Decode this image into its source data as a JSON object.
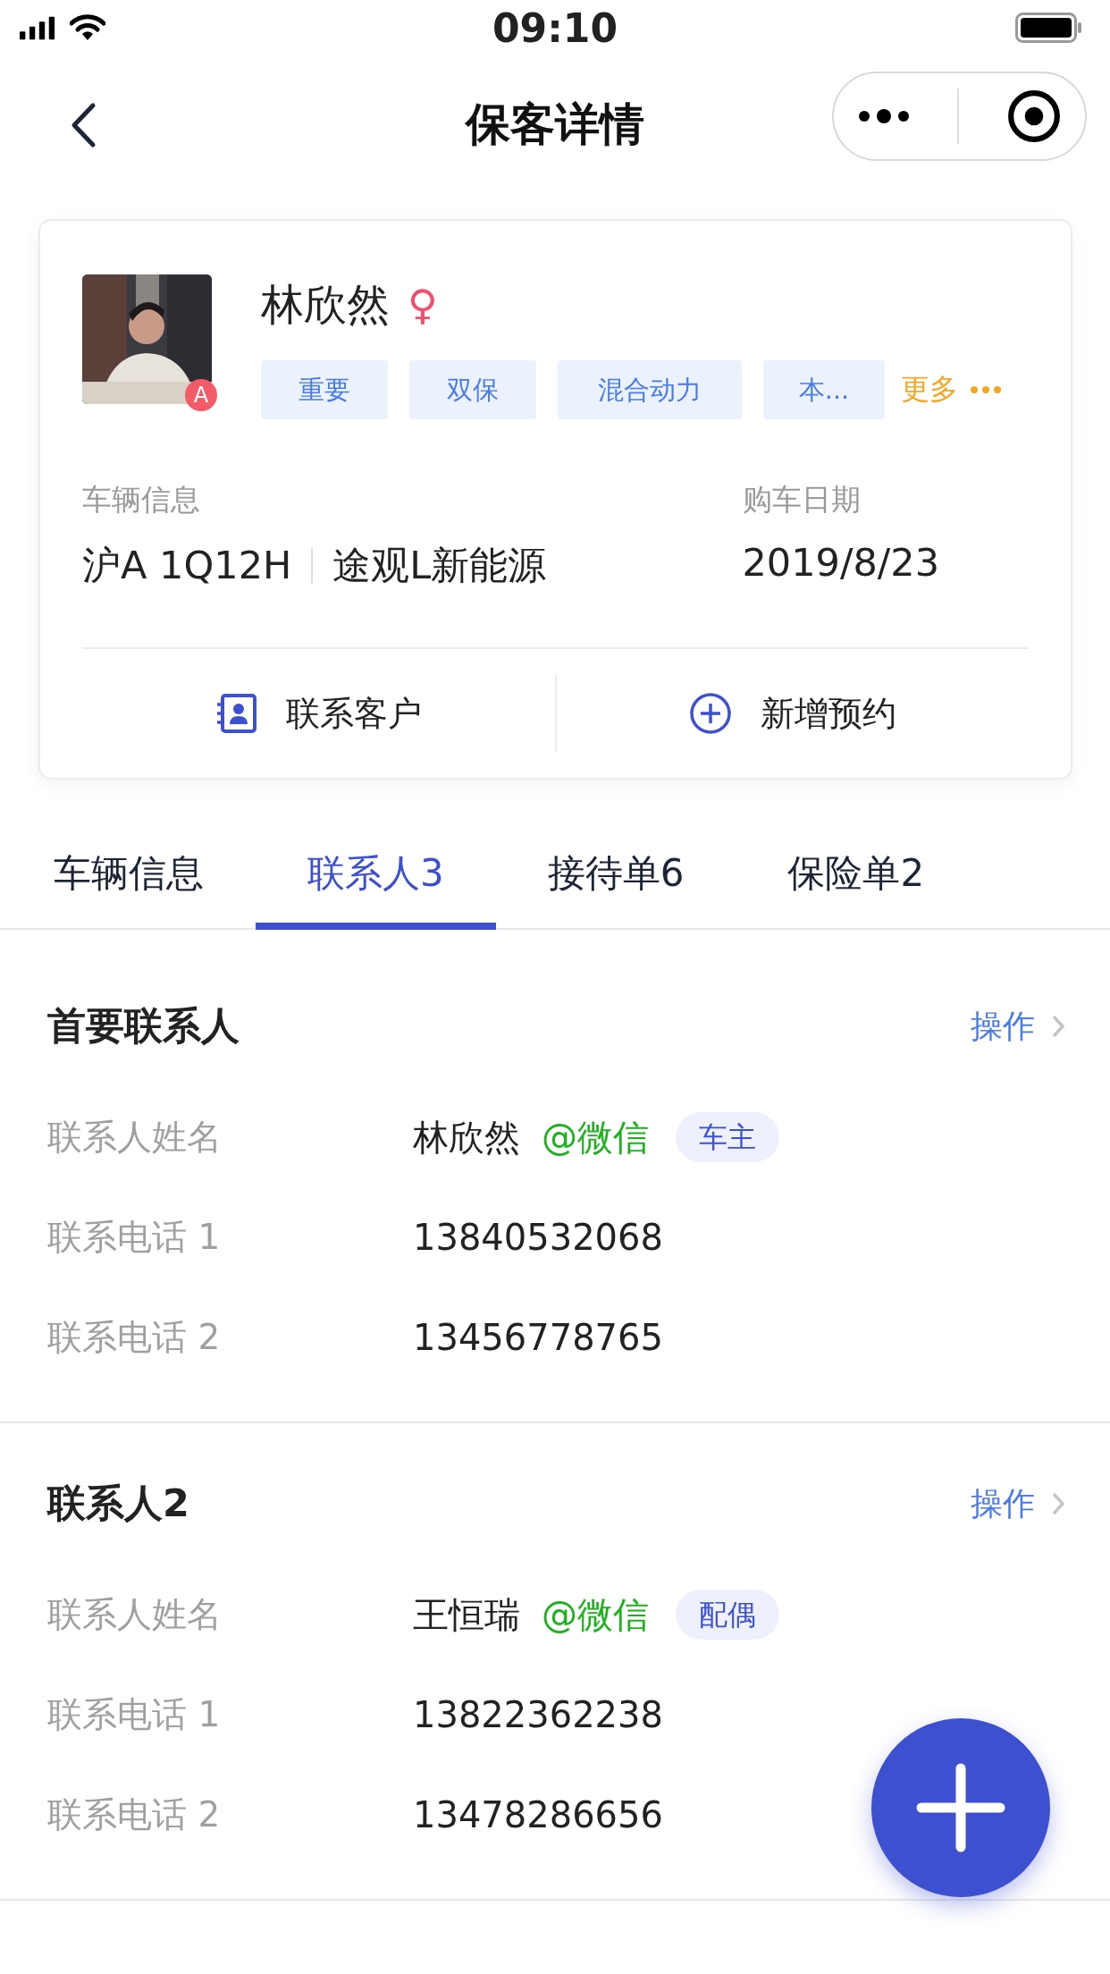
{
  "status_bar": {
    "time": "09:10"
  },
  "nav": {
    "title": "保客详情"
  },
  "customer": {
    "name": "林欣然",
    "gender_symbol": "♀",
    "avatar_badge": "A",
    "tags": [
      "重要",
      "双保",
      "混合动力",
      "本..."
    ],
    "more": "更多",
    "vehicle_label": "车辆信息",
    "plate": "沪A 1Q12H",
    "model": "途观L新能源",
    "date_label": "购车日期",
    "date": "2019/8/23",
    "actions": [
      {
        "kind": "contact",
        "label": "联系客户"
      },
      {
        "kind": "add",
        "label": "新增预约"
      }
    ]
  },
  "tabs": [
    {
      "label": "车辆信息",
      "selected": false
    },
    {
      "label": "联系人3",
      "selected": true
    },
    {
      "label": "接待单6",
      "selected": false
    },
    {
      "label": "保险单2",
      "selected": false
    }
  ],
  "contacts": [
    {
      "title": "首要联系人",
      "action": "操作",
      "fields": [
        {
          "label": "联系人姓名",
          "value": "林欣然",
          "wechat": "@微信",
          "role": "车主"
        },
        {
          "label": "联系电话 1",
          "value": "13840532068"
        },
        {
          "label": "联系电话 2",
          "value": "13456778765"
        }
      ]
    },
    {
      "title": "联系人2",
      "action": "操作",
      "fields": [
        {
          "label": "联系人姓名",
          "value": "王恒瑞",
          "wechat": "@微信",
          "role": "配偶"
        },
        {
          "label": "联系电话 1",
          "value": "13822362238"
        },
        {
          "label": "联系电话 2",
          "value": "13478286656"
        }
      ]
    }
  ]
}
